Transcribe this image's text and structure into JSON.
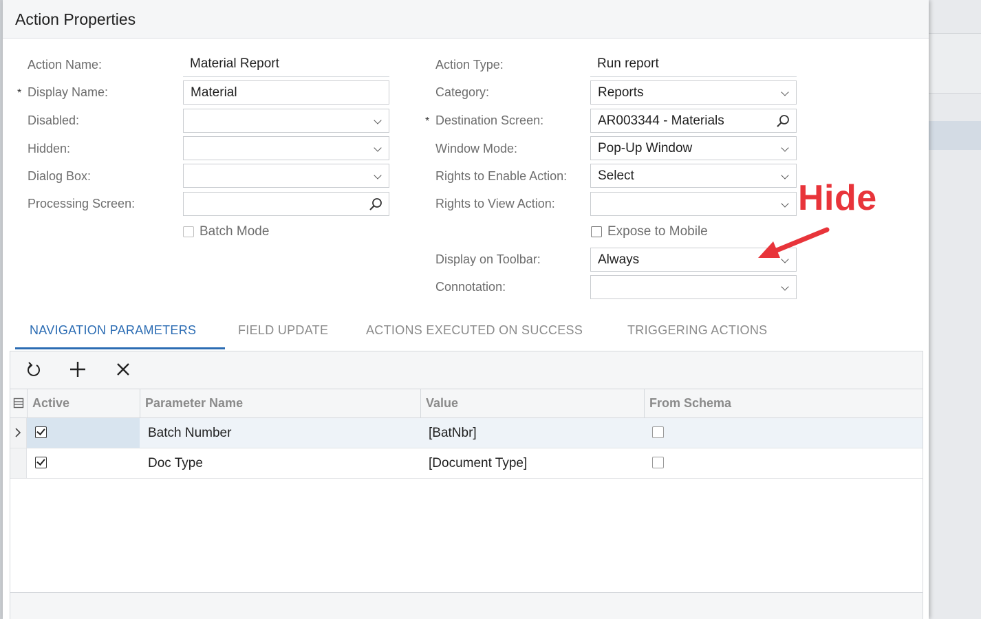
{
  "dialog": {
    "title": "Action Properties"
  },
  "left_form": {
    "action_name": {
      "label": "Action Name:",
      "value": "Material Report"
    },
    "display_name": {
      "label": "Display Name:",
      "value": "Material",
      "required": "*"
    },
    "disabled": {
      "label": "Disabled:",
      "value": ""
    },
    "hidden": {
      "label": "Hidden:",
      "value": ""
    },
    "dialog_box": {
      "label": "Dialog Box:",
      "value": ""
    },
    "processing_screen": {
      "label": "Processing Screen:",
      "value": ""
    },
    "batch_mode": {
      "label": "Batch Mode",
      "checked": false
    }
  },
  "right_form": {
    "action_type": {
      "label": "Action Type:",
      "value": "Run report"
    },
    "category": {
      "label": "Category:",
      "value": "Reports"
    },
    "destination_screen": {
      "label": "Destination Screen:",
      "value": "AR003344 - Materials",
      "required": "*"
    },
    "window_mode": {
      "label": "Window Mode:",
      "value": "Pop-Up Window"
    },
    "rights_enable": {
      "label": "Rights to Enable Action:",
      "value": "Select"
    },
    "rights_view": {
      "label": "Rights to View Action:",
      "value": ""
    },
    "expose_mobile": {
      "label": "Expose to Mobile",
      "checked": false
    },
    "display_toolbar": {
      "label": "Display on Toolbar:",
      "value": "Always"
    },
    "connotation": {
      "label": "Connotation:",
      "value": ""
    }
  },
  "annotation": {
    "text": "Hide",
    "color": "#e8343a"
  },
  "tabs": [
    {
      "label": "NAVIGATION PARAMETERS",
      "active": true
    },
    {
      "label": "FIELD UPDATE",
      "active": false
    },
    {
      "label": "ACTIONS EXECUTED ON SUCCESS",
      "active": false
    },
    {
      "label": "TRIGGERING ACTIONS",
      "active": false
    }
  ],
  "toolbar": {
    "icons": [
      "refresh-icon",
      "add-icon",
      "delete-icon"
    ]
  },
  "grid": {
    "columns": [
      "Active",
      "Parameter Name",
      "Value",
      "From Schema"
    ],
    "rows": [
      {
        "active": true,
        "parameter_name": "Batch Number",
        "value": "[BatNbr]",
        "from_schema": false,
        "selected": true
      },
      {
        "active": true,
        "parameter_name": "Doc Type",
        "value": "[Document Type]",
        "from_schema": false,
        "selected": false
      }
    ]
  },
  "colors": {
    "accent": "#2b6cb3",
    "annotation": "#e8343a"
  }
}
